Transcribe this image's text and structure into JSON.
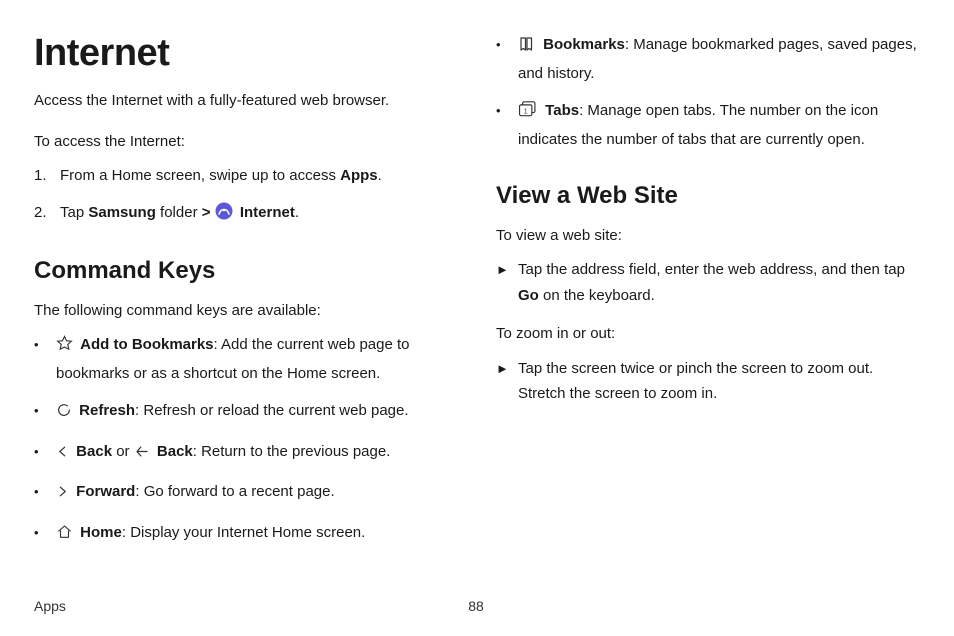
{
  "title": "Internet",
  "intro": "Access the Internet with a fully-featured web browser.",
  "accessIntro": "To access the Internet:",
  "steps": {
    "s1_pre": "From a Home screen, swipe up to access ",
    "s1_b": "Apps",
    "s1_post": ".",
    "s2_pre": "Tap ",
    "s2_b1": "Samsung",
    "s2_mid": " folder ",
    "s2_chev": ">",
    "s2_b2": " Internet",
    "s2_post": "."
  },
  "sec1": {
    "heading": "Command Keys",
    "intro": "The following command keys are available:",
    "items": {
      "a_b": "Add to Bookmarks",
      "a_t": ": Add the current web page to bookmarks or as a shortcut on the Home screen.",
      "b_b": "Refresh",
      "b_t": ": Refresh or reload the current web page.",
      "c_b1": "Back",
      "c_mid": " or ",
      "c_b2": "Back",
      "c_t": ": Return to the previous page.",
      "d_b": "Forward",
      "d_t": ": Go forward to a recent page.",
      "e_b": "Home",
      "e_t": ": Display your Internet Home screen.",
      "f_b": "Bookmarks",
      "f_t": ": Manage bookmarked pages, saved pages, and history.",
      "g_b": "Tabs",
      "g_t": ": Manage open tabs. The number on the icon indicates the number of tabs that are currently open."
    }
  },
  "sec2": {
    "heading": "View a Web Site",
    "intro1": "To view a web site:",
    "item1_pre": "Tap the address field, enter the web address, and then tap ",
    "item1_b": "Go",
    "item1_post": " on the keyboard.",
    "intro2": "To zoom in or out:",
    "item2": "Tap the screen twice or pinch the screen to zoom out. Stretch the screen to zoom in."
  },
  "footer": {
    "section": "Apps",
    "page": "88"
  },
  "glyphs": {
    "bullet": "•",
    "arrow": "►",
    "n1": "1.",
    "n2": "2."
  }
}
